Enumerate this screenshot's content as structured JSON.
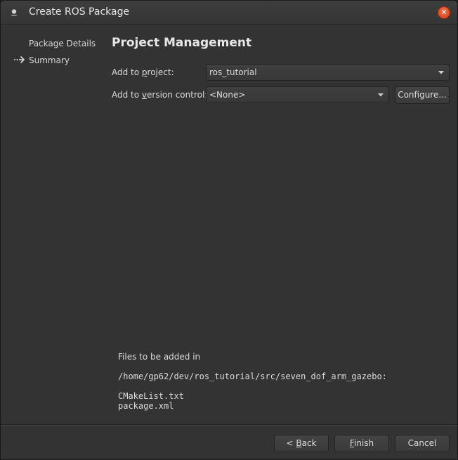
{
  "window": {
    "title": "Create ROS Package",
    "icon": "ros-app-icon",
    "close_icon": "close-icon",
    "accent_close": "#e2522a"
  },
  "sidebar": {
    "steps": [
      {
        "label": "Package Details",
        "current": false
      },
      {
        "label": "Summary",
        "current": true
      }
    ],
    "current_marker_icon": "arrow-right-icon"
  },
  "main": {
    "heading": "Project Management",
    "project": {
      "label_pre": "Add to ",
      "label_mnemonic": "p",
      "label_post": "roject:",
      "value": "ros_tutorial"
    },
    "version_control": {
      "label_pre": "Add to ",
      "label_mnemonic": "v",
      "label_post": "ersion control:",
      "value": "<None>",
      "configure_label": "Configure..."
    },
    "files": {
      "intro": "Files to be added in",
      "path": "/home/gp62/dev/ros_tutorial/src/seven_dof_arm_gazebo:",
      "list": [
        "CMakeList.txt",
        "package.xml"
      ]
    }
  },
  "footer": {
    "back_prefix": "< ",
    "back_mnemonic": "B",
    "back_rest": "ack",
    "finish_mnemonic": "F",
    "finish_rest": "inish",
    "cancel_label": "Cancel"
  }
}
